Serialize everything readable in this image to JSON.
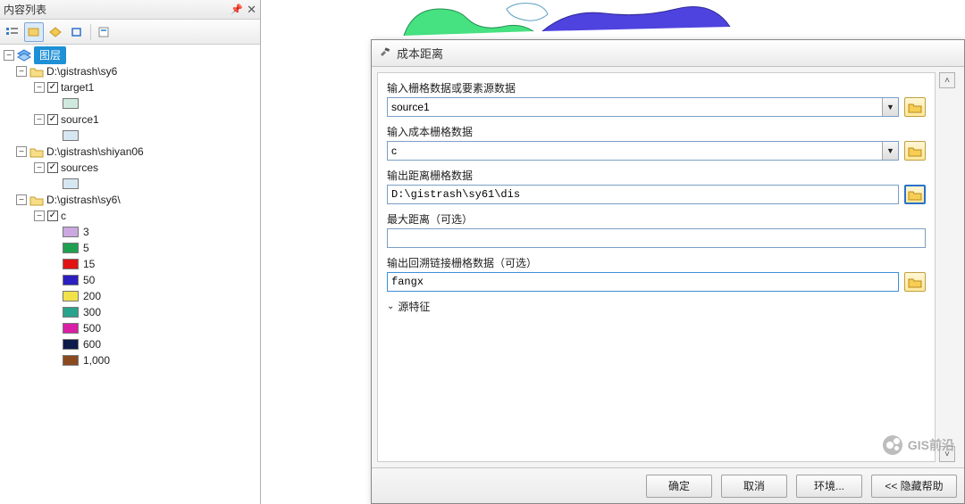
{
  "toc": {
    "title": "内容列表",
    "root_label": "图层",
    "groups": [
      {
        "path": "D:\\gistrash\\sy6",
        "layers": [
          {
            "name": "target1",
            "checked": true,
            "swatch": "#cfe9de"
          },
          {
            "name": "source1",
            "checked": true,
            "swatch": "#d6e7f2"
          }
        ]
      },
      {
        "path": "D:\\gistrash\\shiyan06",
        "layers": [
          {
            "name": "sources",
            "checked": true,
            "swatch": "#d6e7f2"
          }
        ]
      },
      {
        "path": "D:\\gistrash\\sy6\\",
        "layers": [
          {
            "name": "c",
            "checked": true,
            "classes": [
              {
                "label": "3",
                "color": "#cba8e0"
              },
              {
                "label": "5",
                "color": "#1fa050"
              },
              {
                "label": "15",
                "color": "#e11414"
              },
              {
                "label": "50",
                "color": "#2b1fbf"
              },
              {
                "label": "200",
                "color": "#f2e24a"
              },
              {
                "label": "300",
                "color": "#2aa38c"
              },
              {
                "label": "500",
                "color": "#d91fa6"
              },
              {
                "label": "600",
                "color": "#0d1a4a"
              },
              {
                "label": "1,000",
                "color": "#8a4a1f"
              }
            ]
          }
        ]
      }
    ]
  },
  "dialog": {
    "title": "成本距离",
    "fields": {
      "source_label": "输入栅格数据或要素源数据",
      "source_value": "source1",
      "cost_label": "输入成本栅格数据",
      "cost_value": "c",
      "outdist_label": "输出距离栅格数据",
      "outdist_value": "D:\\gistrash\\sy61\\dis",
      "maxdist_label": "最大距离（可选）",
      "maxdist_value": "",
      "backlink_label": "输出回溯链接栅格数据（可选）",
      "backlink_value": "fangx"
    },
    "section_toggle": "源特征",
    "buttons": {
      "ok": "确定",
      "cancel": "取消",
      "env": "环境...",
      "help": "<< 隐藏帮助"
    }
  },
  "watermark": "GIS前沿",
  "icons": {
    "expander_minus": "−"
  }
}
